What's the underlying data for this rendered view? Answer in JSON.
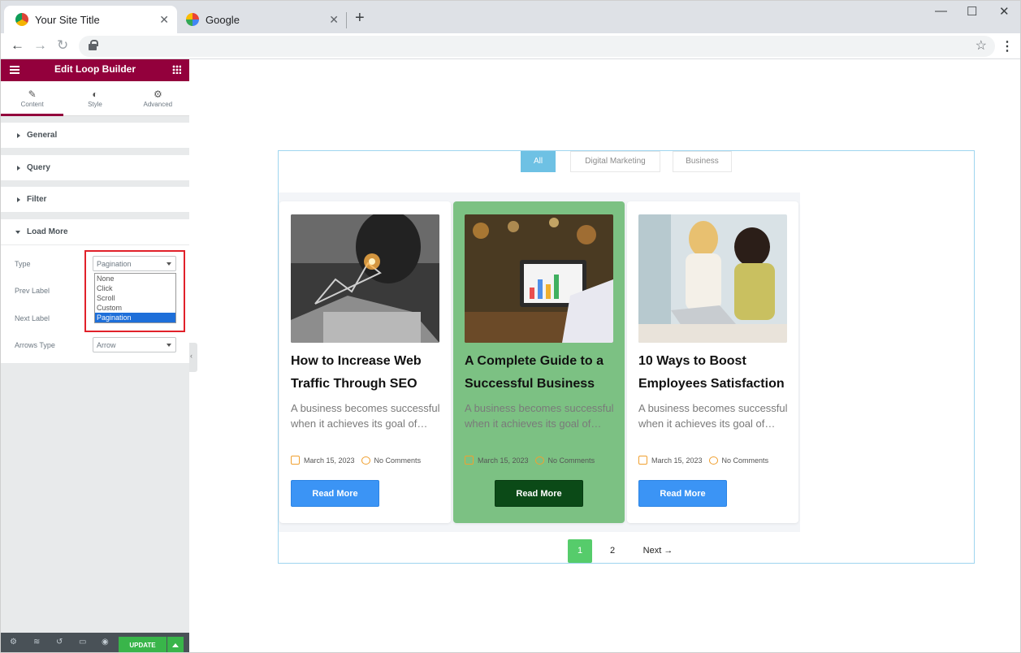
{
  "browser": {
    "tabs": [
      {
        "title": "Your Site Title",
        "active": true
      },
      {
        "title": "Google",
        "active": false
      }
    ],
    "new_tab_glyph": "+",
    "close_glyph": "✕",
    "icons": [
      "chrome-icon",
      "google-icon",
      "back-icon",
      "forward-icon",
      "reload-icon",
      "lock-icon",
      "star-icon",
      "menu-icon"
    ]
  },
  "panel": {
    "title": "Edit Loop Builder",
    "accent": "#93003c",
    "tabs": [
      {
        "label": "Content",
        "icon": "pencil-icon"
      },
      {
        "label": "Style",
        "icon": "contrast-icon"
      },
      {
        "label": "Advanced",
        "icon": "gear-icon"
      }
    ],
    "sections": [
      "General",
      "Query",
      "Filter",
      "Load More"
    ],
    "controls": {
      "type_label": "Type",
      "type_value": "Pagination",
      "prev_label": "Prev Label",
      "next_label": "Next Label",
      "arrows_label": "Arrows Type",
      "arrows_value": "Arrow",
      "type_options": [
        "None",
        "Click",
        "Scroll",
        "Custom",
        "Pagination"
      ],
      "selected_option": "Pagination"
    },
    "footer": {
      "update_label": "UPDATE",
      "icons": [
        "settings-icon",
        "layers-icon",
        "history-icon",
        "responsive-icon",
        "preview-icon"
      ]
    }
  },
  "filters": [
    {
      "label": "All",
      "active": true
    },
    {
      "label": "Digital Marketing",
      "active": false
    },
    {
      "label": "Business",
      "active": false
    }
  ],
  "cards": [
    {
      "title": "How to Increase Web Traffic Through SEO",
      "excerpt": "A business becomes successful when it achieves its goal of…",
      "date": "March 15, 2023",
      "comments": "No Comments",
      "button": "Read More",
      "highlighted": false
    },
    {
      "title": "A Complete Guide to a Successful Business",
      "excerpt": "A business becomes successful when it achieves its goal of…",
      "date": "March 15, 2023",
      "comments": "No Comments",
      "button": "Read More",
      "highlighted": true
    },
    {
      "title": "10 Ways to Boost Employees Satisfaction",
      "excerpt": "A business becomes successful when it achieves its goal of…",
      "date": "March 15, 2023",
      "comments": "No Comments",
      "button": "Read More",
      "highlighted": false
    }
  ],
  "pagination": {
    "pages": [
      "1",
      "2"
    ],
    "current": "1",
    "next": "Next →"
  }
}
